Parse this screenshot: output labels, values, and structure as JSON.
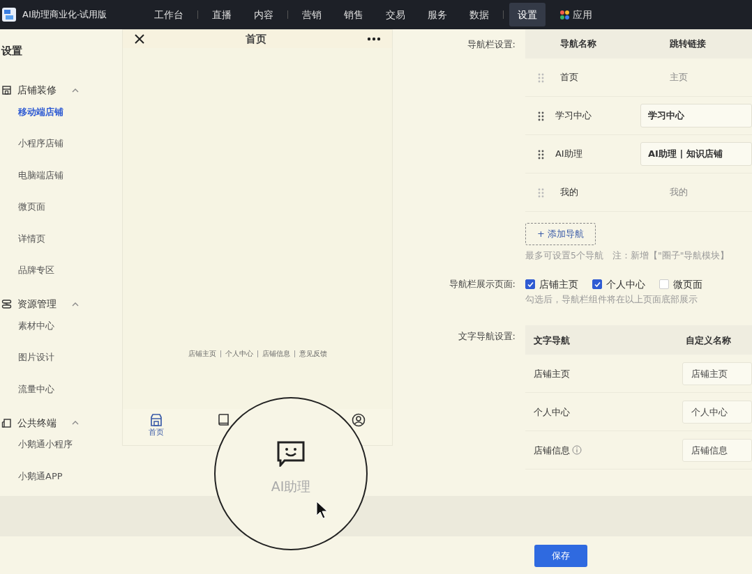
{
  "topbar": {
    "brand": "AI助理商业化-试用版",
    "menu_groups": [
      [
        {
          "label": "工作台",
          "selected": false,
          "kind": "text"
        }
      ],
      [
        {
          "label": "直播",
          "selected": false,
          "kind": "text"
        },
        {
          "label": "内容",
          "selected": false,
          "kind": "text"
        }
      ],
      [
        {
          "label": "营销",
          "selected": false,
          "kind": "text"
        },
        {
          "label": "销售",
          "selected": false,
          "kind": "text"
        },
        {
          "label": "交易",
          "selected": false,
          "kind": "text"
        },
        {
          "label": "服务",
          "selected": false,
          "kind": "text"
        },
        {
          "label": "数据",
          "selected": false,
          "kind": "text"
        }
      ],
      [
        {
          "label": "设置",
          "selected": true,
          "kind": "text"
        },
        {
          "label": "应用",
          "selected": false,
          "kind": "apps"
        }
      ]
    ]
  },
  "sidebar": {
    "title": "设置",
    "groups": [
      {
        "label": "店铺装修",
        "expanded": true,
        "items": [
          {
            "label": "移动端店铺",
            "selected": true
          },
          {
            "label": "小程序店铺",
            "selected": false
          },
          {
            "label": "电脑端店铺",
            "selected": false
          },
          {
            "label": "微页面",
            "selected": false
          },
          {
            "label": "详情页",
            "selected": false
          },
          {
            "label": "品牌专区",
            "selected": false
          }
        ]
      },
      {
        "label": "资源管理",
        "expanded": true,
        "items": [
          {
            "label": "素材中心",
            "selected": false
          },
          {
            "label": "图片设计",
            "selected": false
          },
          {
            "label": "流量中心",
            "selected": false
          }
        ]
      },
      {
        "label": "公共终端",
        "expanded": true,
        "items": [
          {
            "label": "小鹅通小程序",
            "selected": false
          },
          {
            "label": "小鹅通APP",
            "selected": false
          }
        ]
      }
    ]
  },
  "preview": {
    "title": "首页",
    "footer_links": [
      "店铺主页",
      "个人中心",
      "店铺信息",
      "意见反馈"
    ],
    "tabs": [
      {
        "label": "首页",
        "selected": true
      },
      {
        "selected": false
      },
      {
        "selected": false
      }
    ],
    "magnifier": {
      "label": "AI助理"
    }
  },
  "nav_settings": {
    "label": "导航栏设置:",
    "columns": [
      "导航名称",
      "跳转链接"
    ],
    "rows": [
      {
        "name": "首页",
        "link": "主页",
        "fixed": true
      },
      {
        "name": "学习中心",
        "link": "学习中心",
        "fixed": false
      },
      {
        "name": "AI助理",
        "link": "AI助理 | 知识店铺",
        "fixed": false
      },
      {
        "name": "我的",
        "link": "我的",
        "fixed": true
      }
    ],
    "add_button": "+ 添加导航",
    "hint": "最多可设置5个导航　注：新增【\"圈子\"导航模块】"
  },
  "display_pages": {
    "label": "导航栏展示页面:",
    "options": [
      {
        "label": "店铺主页",
        "checked": true
      },
      {
        "label": "个人中心",
        "checked": true
      },
      {
        "label": "微页面",
        "checked": false
      }
    ],
    "hint": "勾选后，导航栏组件将在以上页面底部展示"
  },
  "text_nav": {
    "label": "文字导航设置:",
    "columns": [
      "文字导航",
      "自定义名称"
    ],
    "rows": [
      {
        "name": "店铺主页",
        "value": "店铺主页",
        "info": false
      },
      {
        "name": "个人中心",
        "value": "个人中心",
        "info": false
      },
      {
        "name": "店铺信息",
        "value": "店铺信息",
        "info": true
      }
    ]
  },
  "save_button": "保存"
}
